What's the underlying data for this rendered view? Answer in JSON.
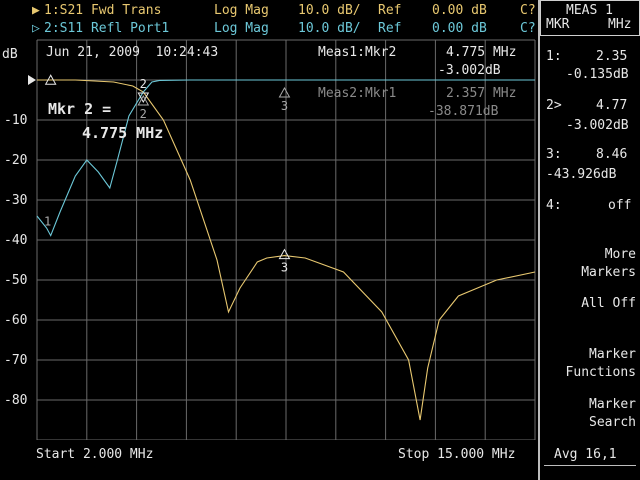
{
  "header": {
    "trace1": {
      "id": "1:S21 Fwd Trans",
      "format": "Log Mag",
      "scale": "10.0 dB/",
      "ref_label": "Ref",
      "ref_value": "0.00 dB",
      "cal": "C?"
    },
    "trace2": {
      "id": "2:S11 Refl Port1",
      "format": "Log Mag",
      "scale": "10.0 dB/",
      "ref_label": "Ref",
      "ref_value": "0.00 dB",
      "cal": "C?"
    }
  },
  "plot": {
    "unit_label": "dB",
    "timestamp": "Jun 21, 2009  10:24:43",
    "y_ticks": [
      "-10",
      "-20",
      "-30",
      "-40",
      "-50",
      "-60",
      "-70",
      "-80"
    ],
    "meas1": {
      "label": "Meas1:Mkr2",
      "freq": "4.775 MHz",
      "value": "-3.002dB"
    },
    "meas2": {
      "label": "Meas2:Mkr1",
      "freq": "2.357 MHz",
      "value": "-38.871dB"
    },
    "marker_readout": {
      "line1": "Mkr 2 =",
      "line2": "4.775 MHz"
    },
    "markers": {
      "m1": "1",
      "m2": "2",
      "m3": "3"
    },
    "start_label": "Start 2.000 MHz",
    "stop_label": "Stop 15.000 MHz",
    "colors": {
      "trace1": "#e8c870",
      "trace2": "#6cc8d8",
      "grid": "#6a6a6a"
    }
  },
  "chart_data": {
    "type": "line",
    "x_range_mhz": [
      2.0,
      15.0
    ],
    "ylim": [
      -90,
      10
    ],
    "grid": true,
    "series": [
      {
        "name": "1:S21 Fwd Trans",
        "x": [
          2.0,
          3.0,
          4.0,
          4.5,
          4.775,
          5.3,
          6.0,
          6.7,
          7.0,
          7.3,
          7.75,
          8.0,
          8.46,
          9.0,
          10.0,
          11.0,
          11.7,
          12.0,
          12.2,
          12.5,
          13.0,
          14.0,
          15.0
        ],
        "y": [
          0.0,
          0.0,
          -0.5,
          -1.5,
          -3.0,
          -10.0,
          -25.0,
          -45.0,
          -58.0,
          -52.0,
          -45.5,
          -44.5,
          -43.9,
          -44.5,
          -48.0,
          -58.0,
          -70.0,
          -85.0,
          -72.0,
          -60.0,
          -54.0,
          -50.0,
          -48.0
        ]
      },
      {
        "name": "2:S11 Refl Port1",
        "x": [
          2.0,
          2.25,
          2.357,
          2.6,
          3.0,
          3.3,
          3.6,
          3.9,
          4.1,
          4.4,
          4.775,
          5.0,
          5.2,
          6.0,
          8.0,
          10.0,
          12.0,
          15.0
        ],
        "y": [
          -34.0,
          -37.0,
          -38.9,
          -33.0,
          -24.0,
          -20.0,
          -23.0,
          -27.0,
          -20.0,
          -9.0,
          -3.0,
          -0.5,
          -0.1,
          0.0,
          0.0,
          0.0,
          0.0,
          0.0
        ]
      }
    ]
  },
  "softkeys": {
    "title_line1": "MEAS 1",
    "title_line2_left": "MKR",
    "title_line2_right": "MHz",
    "marker_rows": [
      {
        "num": "1:",
        "freq": "2.35",
        "value": "-0.135dB"
      },
      {
        "num": "2>",
        "freq": "4.77",
        "value": "-3.002dB"
      },
      {
        "num": "3:",
        "freq": "8.46",
        "value": "-43.926dB"
      },
      {
        "num": "4:",
        "freq": "off"
      }
    ],
    "more_markers_1": "More",
    "more_markers_2": "Markers",
    "all_off": "All Off",
    "marker_functions_1": "Marker",
    "marker_functions_2": "Functions",
    "marker_search_1": "Marker",
    "marker_search_2": "Search",
    "avg": "Avg 16,1"
  }
}
